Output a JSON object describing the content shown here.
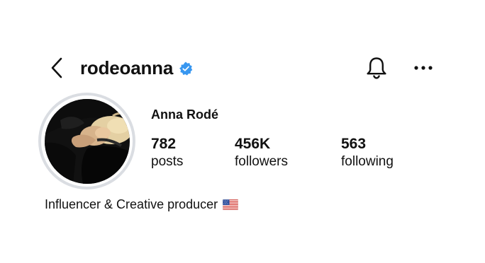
{
  "header": {
    "username": "rodeoanna",
    "verified": true,
    "back_icon": "chevron-left-icon",
    "notification_icon": "bell-icon",
    "more_icon": "more-horizontal-icon"
  },
  "profile": {
    "display_name": "Anna Rodé",
    "avatar_description": "profile photo",
    "stats": [
      {
        "count": "782",
        "label": "posts"
      },
      {
        "count": "456K",
        "label": "followers"
      },
      {
        "count": "563",
        "label": "following"
      }
    ],
    "bio": "Influencer & Creative producer",
    "bio_emoji": "us-flag-emoji"
  },
  "colors": {
    "verified_badge": "#3897f0",
    "avatar_ring": "#dadde2",
    "text": "#111111"
  }
}
